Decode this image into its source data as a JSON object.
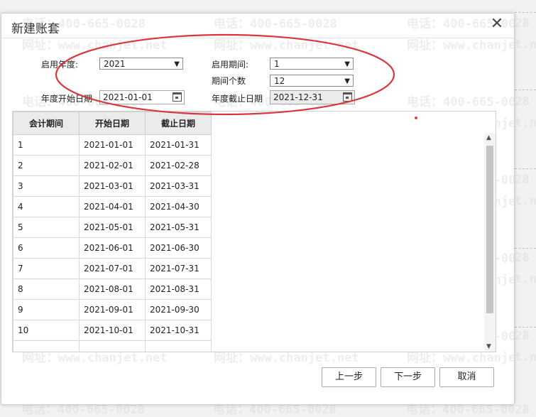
{
  "watermark": {
    "phone": "电话：400-665-0028",
    "site": "网址：www.chanjet.net"
  },
  "dialog": {
    "title": "新建账套",
    "close_glyph": "✕",
    "fields": {
      "start_year_label": "启用年度:",
      "start_year_value": "2021",
      "start_period_label": "启用期间:",
      "start_period_value": "1",
      "period_count_label": "期间个数",
      "period_count_value": "12",
      "year_start_date_label": "年度开始日期",
      "year_start_date_value": "2021-01-01",
      "year_end_date_label": "年度截止日期",
      "year_end_date_value": "2021-12-31"
    },
    "table": {
      "headers": [
        "会计期间",
        "开始日期",
        "截止日期"
      ],
      "rows": [
        [
          "1",
          "2021-01-01",
          "2021-01-31"
        ],
        [
          "2",
          "2021-02-01",
          "2021-02-28"
        ],
        [
          "3",
          "2021-03-01",
          "2021-03-31"
        ],
        [
          "4",
          "2021-04-01",
          "2021-04-30"
        ],
        [
          "5",
          "2021-05-01",
          "2021-05-31"
        ],
        [
          "6",
          "2021-06-01",
          "2021-06-30"
        ],
        [
          "7",
          "2021-07-01",
          "2021-07-31"
        ],
        [
          "8",
          "2021-08-01",
          "2021-08-31"
        ],
        [
          "9",
          "2021-09-01",
          "2021-09-30"
        ],
        [
          "10",
          "2021-10-01",
          "2021-10-31"
        ]
      ]
    },
    "buttons": {
      "prev": "上一步",
      "next": "下一步",
      "cancel": "取消"
    }
  },
  "colors": {
    "annotation_ellipse": "#d9363e"
  }
}
